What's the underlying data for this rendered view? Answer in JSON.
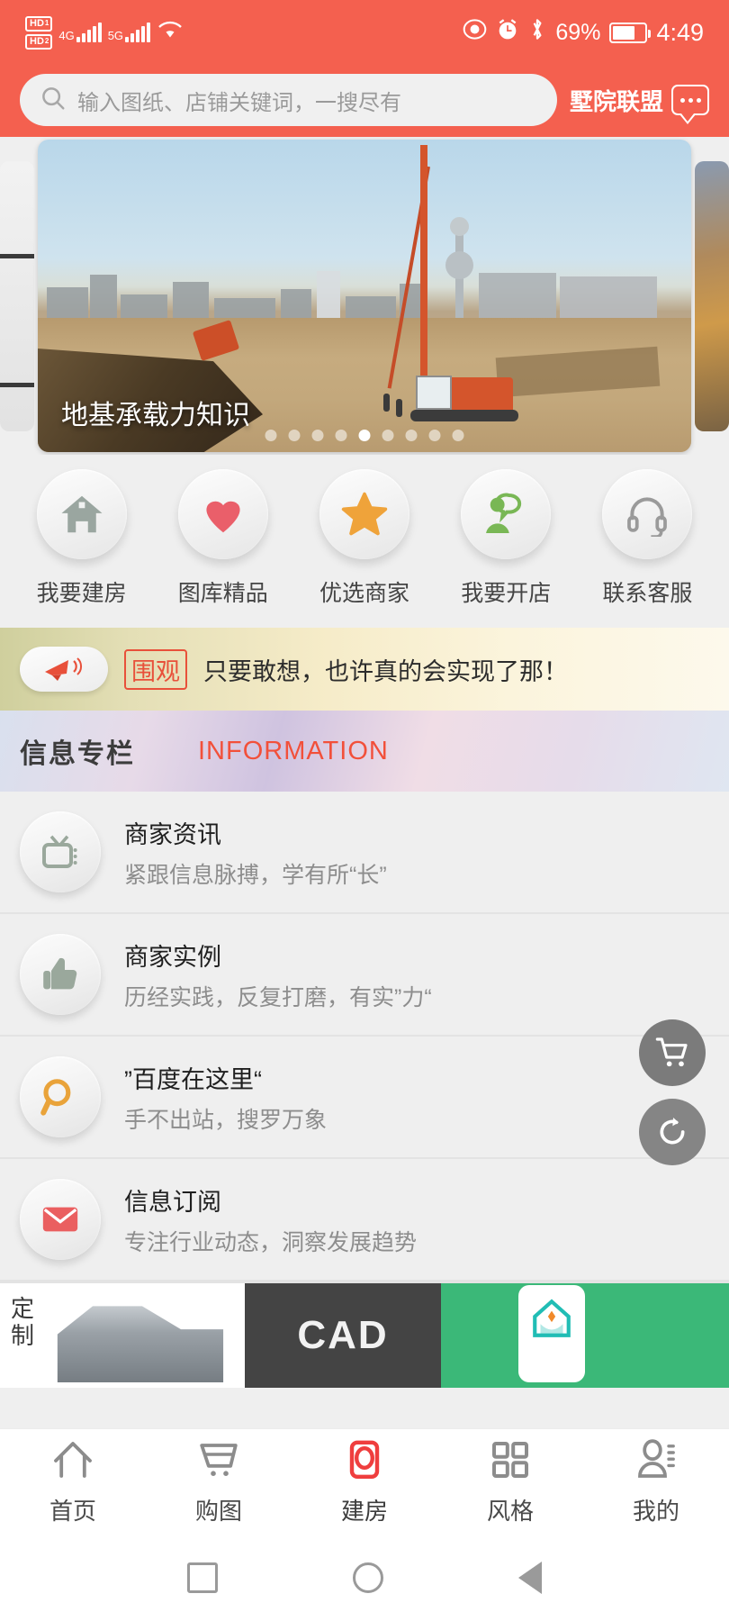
{
  "status_bar": {
    "hd1": "HD",
    "hd1_sub": "1",
    "hd2": "HD",
    "hd2_sub": "2",
    "net1": "4G",
    "net2": "5G",
    "wifi_icon": "wifi-icon",
    "eye_icon": "eye-icon",
    "alarm_icon": "alarm-icon",
    "bluetooth_icon": "bluetooth-icon",
    "battery_percent": "69%",
    "time": "4:49"
  },
  "header": {
    "accent_color": "#f4604f",
    "search_placeholder": "输入图纸、店铺关键词，一搜尽有",
    "search_value": "",
    "search_icon": "search-icon",
    "brand_text": "墅院联盟",
    "message_icon": "message-bubble-icon"
  },
  "carousel": {
    "caption": "地基承载力知识",
    "total_dots": 9,
    "active_dot_index": 4
  },
  "quick_actions": [
    {
      "label": "我要建房",
      "icon": "house-icon",
      "color": "#9aa6a0"
    },
    {
      "label": "图库精品",
      "icon": "heart-icon",
      "color": "#ea5f6a"
    },
    {
      "label": "优选商家",
      "icon": "star-icon",
      "color": "#efa33a"
    },
    {
      "label": "我要开店",
      "icon": "person-bubble-icon",
      "color": "#79b755"
    },
    {
      "label": "联系客服",
      "icon": "headset-icon",
      "color": "#9a9a9a"
    }
  ],
  "notice": {
    "icon": "megaphone-icon",
    "tag": "围观",
    "tag_color": "#e8503a",
    "text": "只要敢想，也许真的会实现了那！"
  },
  "info_section": {
    "title_cn": "信息专栏",
    "title_en": "INFORMATION",
    "title_en_color": "#f2503a",
    "items": [
      {
        "title": "商家资讯",
        "subtitle": "紧跟信息脉搏，学有所“长”",
        "icon": "tv-icon",
        "icon_color": "#9aa89c"
      },
      {
        "title": "商家实例",
        "subtitle": "历经实践，反复打磨，有实”力“",
        "icon": "thumbs-up-icon",
        "icon_color": "#9aa89c"
      },
      {
        "title": "”百度在这里“",
        "subtitle": "手不出站，搜罗万象",
        "icon": "magnifier-icon",
        "icon_color": "#e9a33a"
      },
      {
        "title": "信息订阅",
        "subtitle": "专注行业动态，洞察发展趋势",
        "icon": "envelope-icon",
        "icon_color": "#ea5f60"
      }
    ]
  },
  "floating_buttons": [
    {
      "name": "cart-button",
      "icon": "shopping-cart-icon"
    },
    {
      "name": "refresh-button",
      "icon": "refresh-icon"
    }
  ],
  "card_strip": {
    "card1_side_text": "定制",
    "card1_icon": "house-3d-icon",
    "card2_text": "CAD",
    "card3_icon": "home-app-icon"
  },
  "tab_bar": {
    "active_index": 2,
    "active_color": "#ef3e3e",
    "items": [
      {
        "label": "首页",
        "icon": "home-arrow-icon"
      },
      {
        "label": "购图",
        "icon": "cart-icon"
      },
      {
        "label": "建房",
        "icon": "build-house-icon"
      },
      {
        "label": "风格",
        "icon": "grid-icon"
      },
      {
        "label": "我的",
        "icon": "user-icon"
      }
    ]
  },
  "system_nav": {
    "recents_icon": "square-icon",
    "home_icon": "circle-icon",
    "back_icon": "triangle-back-icon"
  }
}
